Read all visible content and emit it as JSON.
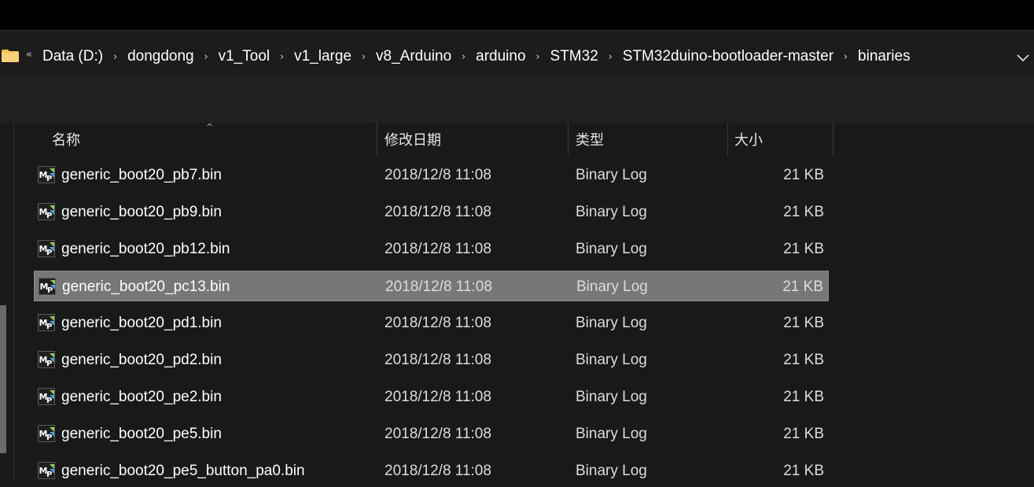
{
  "breadcrumb": {
    "overflow": "«",
    "items": [
      "Data (D:)",
      "dongdong",
      "v1_Tool",
      "v1_large",
      "v8_Arduino",
      "arduino",
      "STM32",
      "STM32duino-bootloader-master",
      "binaries"
    ],
    "separator": "›"
  },
  "columns": {
    "name": "名称",
    "date": "修改日期",
    "type": "类型",
    "size": "大小"
  },
  "sort_indicator": "^",
  "files": [
    {
      "name": "generic_boot20_pb7.bin",
      "date": "2018/12/8 11:08",
      "type": "Binary Log",
      "size": "21 KB"
    },
    {
      "name": "generic_boot20_pb9.bin",
      "date": "2018/12/8 11:08",
      "type": "Binary Log",
      "size": "21 KB"
    },
    {
      "name": "generic_boot20_pb12.bin",
      "date": "2018/12/8 11:08",
      "type": "Binary Log",
      "size": "21 KB"
    },
    {
      "name": "generic_boot20_pc13.bin",
      "date": "2018/12/8 11:08",
      "type": "Binary Log",
      "size": "21 KB",
      "selected": true
    },
    {
      "name": "generic_boot20_pd1.bin",
      "date": "2018/12/8 11:08",
      "type": "Binary Log",
      "size": "21 KB"
    },
    {
      "name": "generic_boot20_pd2.bin",
      "date": "2018/12/8 11:08",
      "type": "Binary Log",
      "size": "21 KB"
    },
    {
      "name": "generic_boot20_pe2.bin",
      "date": "2018/12/8 11:08",
      "type": "Binary Log",
      "size": "21 KB"
    },
    {
      "name": "generic_boot20_pe5.bin",
      "date": "2018/12/8 11:08",
      "type": "Binary Log",
      "size": "21 KB"
    },
    {
      "name": "generic_boot20_pe5_button_pa0.bin",
      "date": "2018/12/8 11:08",
      "type": "Binary Log",
      "size": "21 KB"
    }
  ],
  "colors": {
    "background": "#191919",
    "selected_row": "#777777",
    "folder": "#f2c14e"
  },
  "icons": {
    "folder": "folder-icon",
    "file": "mp-binary-file-icon",
    "dropdown": "chevron-down-icon"
  }
}
